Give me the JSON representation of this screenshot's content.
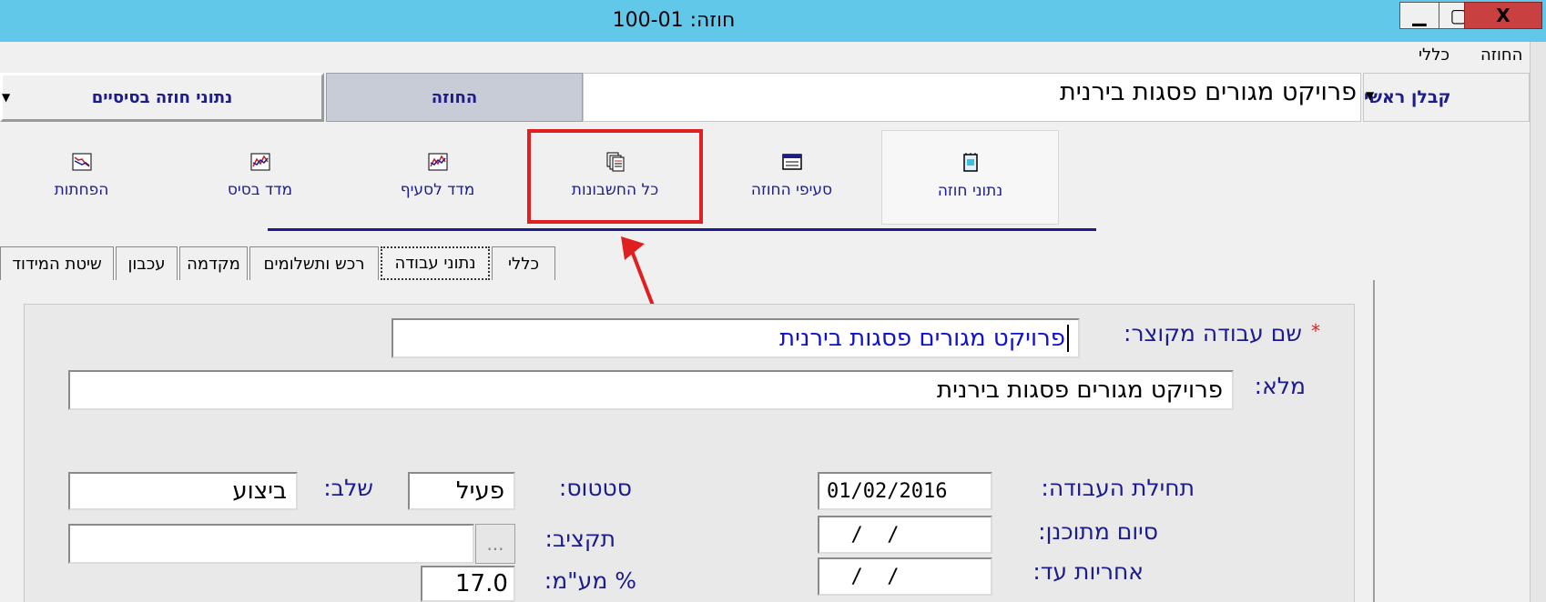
{
  "window": {
    "title": "חוזה: 100-01",
    "minimize": "▁",
    "maximize": "▢",
    "close": "X"
  },
  "menu": {
    "contract": "החוזה",
    "general": "כללי"
  },
  "header": {
    "contractor_label": "קבלן ראשי",
    "project_name": "פרויקט מגורים פסגות בירנית",
    "tab_contract": "החוזה",
    "tab_basic": "נתוני חוזה בסיסיים"
  },
  "toolbar": {
    "contract_data": "נתוני חוזה",
    "contract_sections": "סעיפי החוזה",
    "all_invoices": "כל החשבונות",
    "index_per_section": "מדד לסעיף",
    "base_index": "מדד בסיס",
    "deductions": "הפחתות"
  },
  "tabs": {
    "general": "כללי",
    "work_data": "נתוני עבודה",
    "property_payments": "רכש ותשלומים",
    "advance": "מקדמה",
    "delay": "עכבון",
    "measurement": "שיטת המידוד"
  },
  "form": {
    "required_mark": "*",
    "short_name_label": "שם עבודה מקוצר:",
    "short_name_value": "פרויקט מגורים פסגות בירנית",
    "full_name_label": "מלא:",
    "full_name_value": "פרויקט מגורים פסגות בירנית",
    "start_label": "תחילת העבודה:",
    "start_value": "01/02/2016",
    "planned_end_label": "סיום מתוכנן:",
    "planned_end_value": "  /  /",
    "warranty_label": "אחריות עד:",
    "warranty_value": "  /  /",
    "status_label": "סטטוס:",
    "status_value": "פעיל",
    "stage_label": "שלב:",
    "stage_value": "ביצוע",
    "budget_label": "תקציב:",
    "budget_value": "",
    "budget_button": "...",
    "vat_label": "% מע\"מ:",
    "vat_value": "17.0"
  },
  "colors": {
    "accent": "#1c1c8c",
    "titlebar": "#62c8ea",
    "highlight": "#e02020"
  }
}
